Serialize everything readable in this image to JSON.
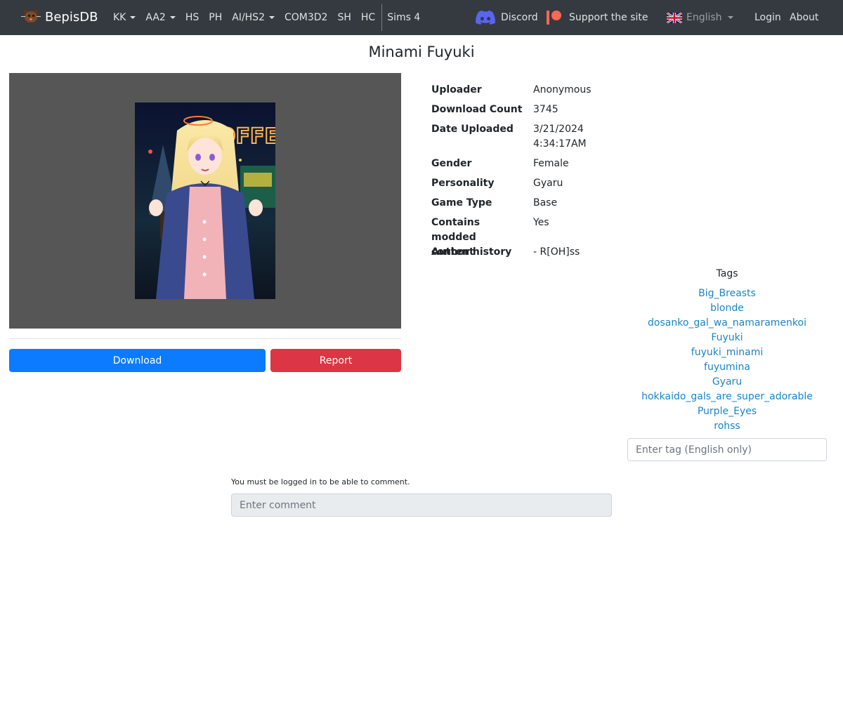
{
  "navbar": {
    "brand": "BepisDB",
    "items": [
      {
        "label": "KK",
        "dropdown": true
      },
      {
        "label": "AA2",
        "dropdown": true
      },
      {
        "label": "HS",
        "dropdown": false
      },
      {
        "label": "PH",
        "dropdown": false
      },
      {
        "label": "AI/HS2",
        "dropdown": true
      },
      {
        "label": "COM3D2",
        "dropdown": false
      },
      {
        "label": "SH",
        "dropdown": false
      },
      {
        "label": "HC",
        "dropdown": false
      },
      {
        "label": "Sims 4",
        "dropdown": false
      }
    ],
    "discord_label": "Discord",
    "support_label": "Support the site",
    "language_label": "English",
    "login_label": "Login",
    "about_label": "About"
  },
  "card": {
    "title": "Minami Fuyuki",
    "download_label": "Download",
    "report_label": "Report",
    "info": [
      {
        "label": "Uploader",
        "value": "Anonymous"
      },
      {
        "label": "Download Count",
        "value": "3745"
      },
      {
        "label": "Date Uploaded",
        "value": "3/21/2024 4:34:17AM"
      },
      {
        "label": "Gender",
        "value": "Female"
      },
      {
        "label": "Personality",
        "value": "Gyaru"
      },
      {
        "label": "Game Type",
        "value": "Base"
      },
      {
        "label": "Contains modded content",
        "value": "Yes"
      },
      {
        "label": "Author history",
        "value": "- R[OH]ss"
      }
    ],
    "tags_title": "Tags",
    "tags": [
      "Big_Breasts",
      "blonde",
      "dosanko_gal_wa_namaramenkoi",
      "Fuyuki",
      "fuyuki_minami",
      "fuyumina",
      "Gyaru",
      "hokkaido_gals_are_super_adorable",
      "Purple_Eyes",
      "rohss"
    ],
    "tag_placeholder": "Enter tag (English only)"
  },
  "comments": {
    "login_note": "You must be logged in to be able to comment.",
    "placeholder": "Enter comment"
  },
  "colors": {
    "navbar_bg": "#343a40",
    "download_button": "#0d7bff",
    "report_button": "#dc3545",
    "tag_link": "#1a85c8",
    "preview_bg": "#565656"
  }
}
